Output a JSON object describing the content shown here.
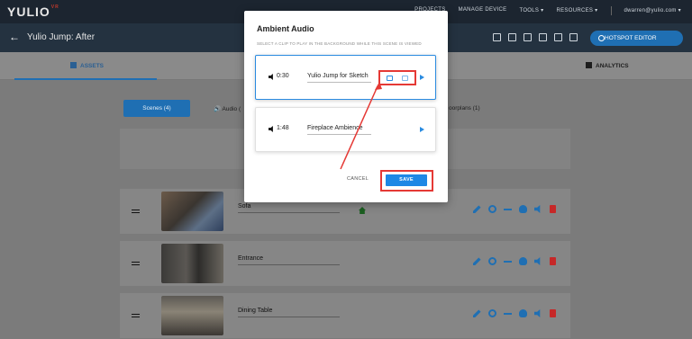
{
  "app": {
    "logo": "YULIO",
    "logo_mark": "VR"
  },
  "topnav": [
    "PROJECTS",
    "MANAGE DEVICE",
    "TOOLS ▾",
    "RESOURCES ▾",
    "dwarren@yulio.com ▾"
  ],
  "header": {
    "title": "Yulio Jump: After",
    "hotspot_button": "HOTSPOT EDITOR"
  },
  "tabs": {
    "assets": "ASSETS",
    "analytics": "ANALYTICS"
  },
  "subtabs": {
    "scenes": "Scenes (4)",
    "audio": "Audio (",
    "floorplans": "oorplans (1)"
  },
  "scenes": [
    {
      "name": "Sofa",
      "is_home": true
    },
    {
      "name": "Entrance",
      "is_home": false
    },
    {
      "name": "Dining Table",
      "is_home": false
    }
  ],
  "modal": {
    "title": "Ambient Audio",
    "subtitle": "SELECT A CLIP TO PLAY IN THE BACKGROUND WHILE THIS SCENE IS VIEWED",
    "clips": [
      {
        "duration": "0:30",
        "name": "Yulio Jump for Sketch"
      },
      {
        "duration": "1:48",
        "name": "Fireplace Ambience"
      }
    ],
    "cancel_label": "CANCEL",
    "save_label": "SAVE"
  },
  "colors": {
    "accent": "#1f6fb3",
    "highlight": "#e53935",
    "home": "#1b5e20",
    "delete": "#c62828"
  }
}
